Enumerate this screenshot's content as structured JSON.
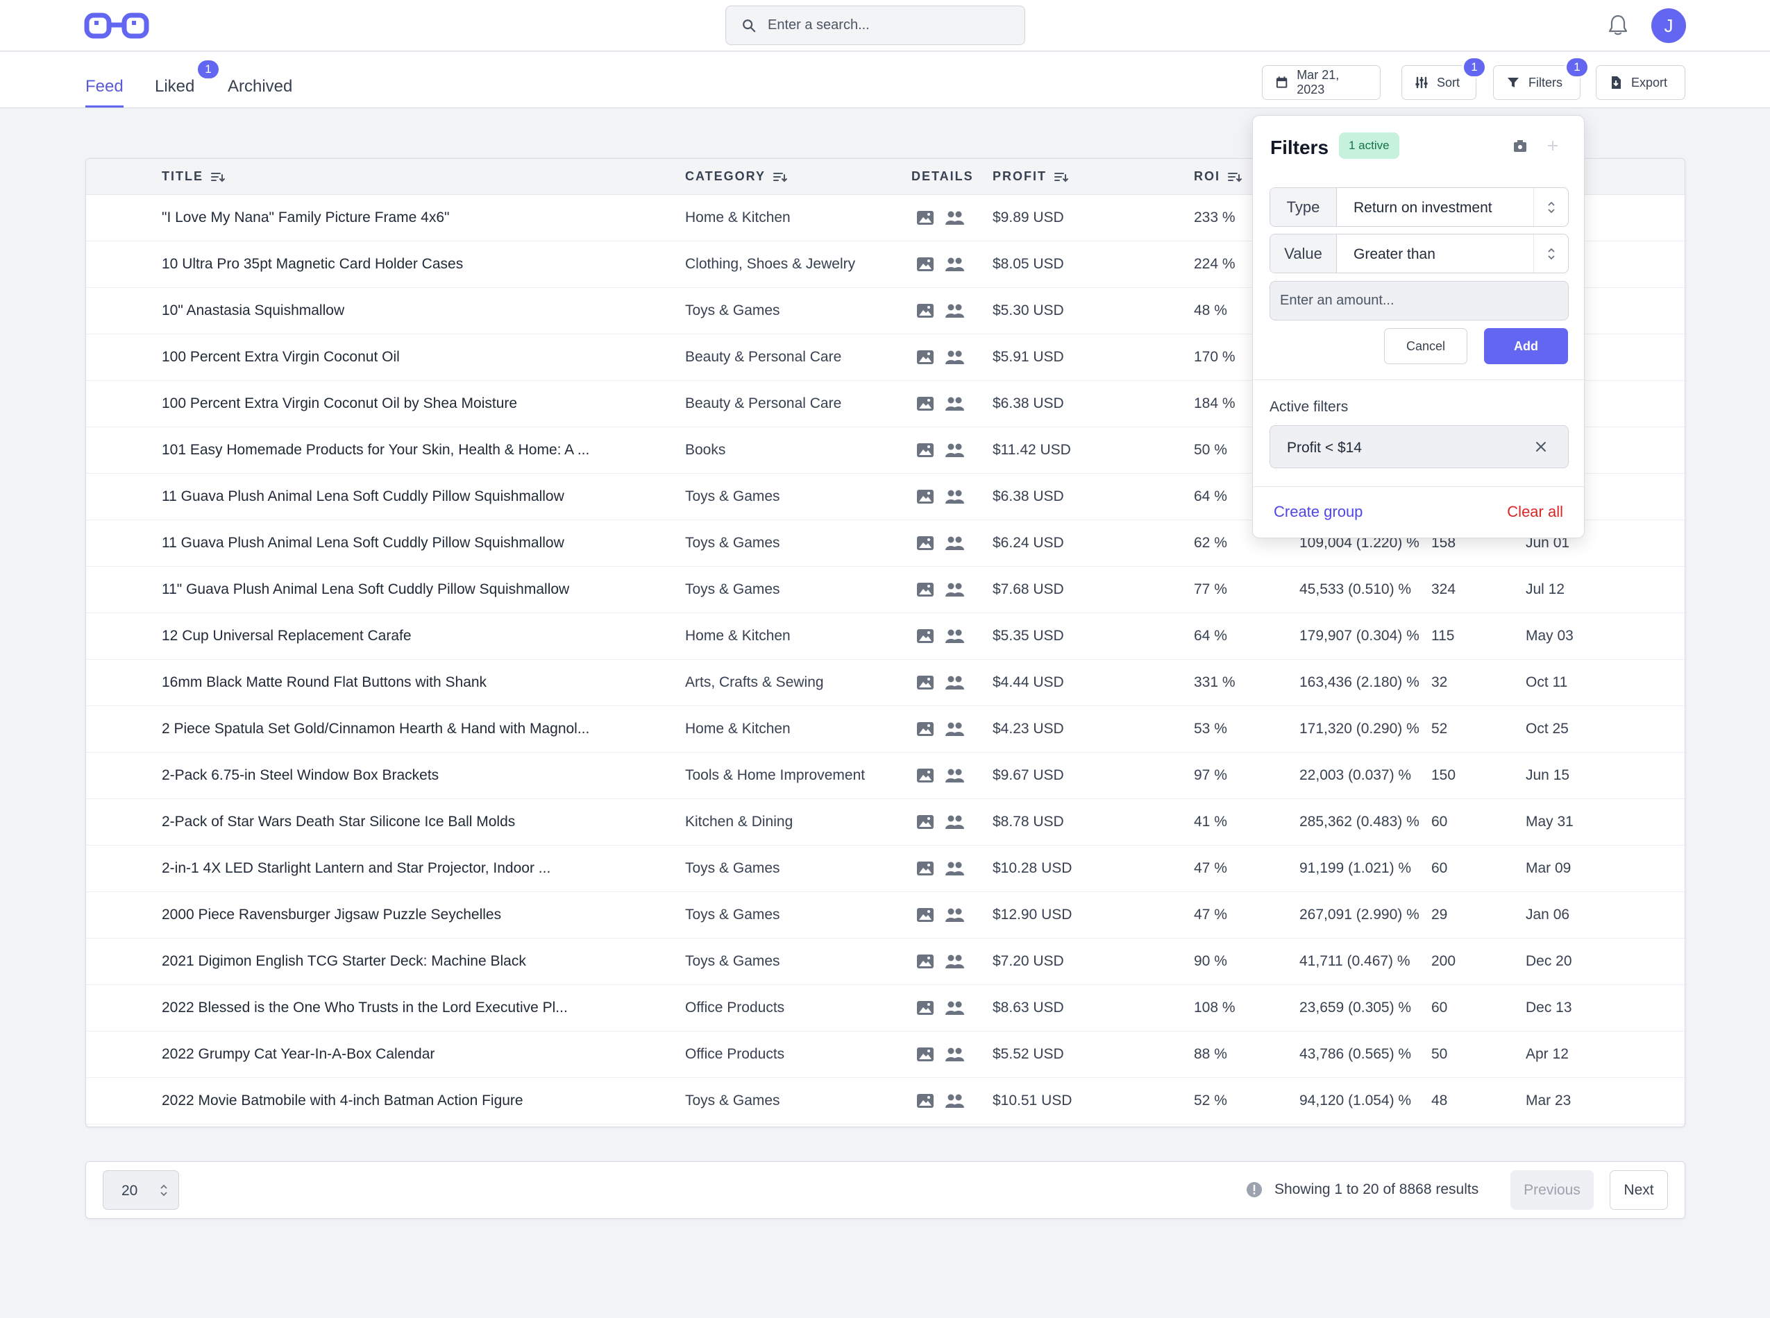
{
  "header": {
    "search_placeholder": "Enter a search...",
    "avatar_initial": "J"
  },
  "tabs": [
    {
      "label": "Feed",
      "active": true
    },
    {
      "label": "Liked",
      "badge": "1"
    },
    {
      "label": "Archived"
    }
  ],
  "toolbar": {
    "date_label": "Mar 21, 2023",
    "sort_label": "Sort",
    "sort_badge": "1",
    "filters_label": "Filters",
    "filters_badge": "1",
    "export_label": "Export"
  },
  "table": {
    "headers": {
      "title": "TITLE",
      "category": "CATEGORY",
      "details": "DETAILS",
      "profit": "PROFIT",
      "roi": "ROI"
    },
    "rows": [
      {
        "title": "\"I Love My Nana\" Family Picture Frame 4x6\"",
        "category": "Home & Kitchen",
        "profit": "$9.89 USD",
        "roi": "233 %",
        "rank": "",
        "count": "",
        "date": ""
      },
      {
        "title": "10 Ultra Pro 35pt Magnetic Card Holder Cases",
        "category": "Clothing, Shoes & Jewelry",
        "profit": "$8.05 USD",
        "roi": "224 %",
        "rank": "",
        "count": "",
        "date": ""
      },
      {
        "title": "10\" Anastasia Squishmallow",
        "category": "Toys & Games",
        "profit": "$5.30 USD",
        "roi": "48 %",
        "rank": "",
        "count": "",
        "date": ""
      },
      {
        "title": "100 Percent Extra Virgin Coconut Oil",
        "category": "Beauty & Personal Care",
        "profit": "$5.91 USD",
        "roi": "170 %",
        "rank": "",
        "count": "",
        "date": ""
      },
      {
        "title": "100 Percent Extra Virgin Coconut Oil by Shea Moisture",
        "category": "Beauty & Personal Care",
        "profit": "$6.38 USD",
        "roi": "184 %",
        "rank": "",
        "count": "",
        "date": ""
      },
      {
        "title": "101 Easy Homemade Products for Your Skin, Health & Home: A ...",
        "category": "Books",
        "profit": "$11.42 USD",
        "roi": "50 %",
        "rank": "",
        "count": "",
        "date": ""
      },
      {
        "title": "11 Guava Plush Animal Lena Soft Cuddly Pillow Squishmallow",
        "category": "Toys & Games",
        "profit": "$6.38 USD",
        "roi": "64 %",
        "rank": "",
        "count": "",
        "date": ""
      },
      {
        "title": "11 Guava Plush Animal Lena Soft Cuddly Pillow Squishmallow",
        "category": "Toys & Games",
        "profit": "$6.24 USD",
        "roi": "62 %",
        "rank": "109,004 (1.220) %",
        "count": "158",
        "date": "Jun 01"
      },
      {
        "title": "11\" Guava Plush Animal Lena Soft Cuddly Pillow Squishmallow",
        "category": "Toys & Games",
        "profit": "$7.68 USD",
        "roi": "77 %",
        "rank": "45,533 (0.510) %",
        "count": "324",
        "date": "Jul 12"
      },
      {
        "title": "12 Cup Universal Replacement Carafe",
        "category": "Home & Kitchen",
        "profit": "$5.35 USD",
        "roi": "64 %",
        "rank": "179,907 (0.304) %",
        "count": "115",
        "date": "May 03"
      },
      {
        "title": "16mm Black Matte Round Flat Buttons with Shank",
        "category": "Arts, Crafts & Sewing",
        "profit": "$4.44 USD",
        "roi": "331 %",
        "rank": "163,436 (2.180) %",
        "count": "32",
        "date": "Oct 11"
      },
      {
        "title": "2 Piece Spatula Set Gold/Cinnamon Hearth & Hand with Magnol...",
        "category": "Home & Kitchen",
        "profit": "$4.23 USD",
        "roi": "53 %",
        "rank": "171,320 (0.290) %",
        "count": "52",
        "date": "Oct 25"
      },
      {
        "title": "2-Pack 6.75-in Steel Window Box Brackets",
        "category": "Tools & Home Improvement",
        "profit": "$9.67 USD",
        "roi": "97 %",
        "rank": "22,003 (0.037) %",
        "count": "150",
        "date": "Jun 15"
      },
      {
        "title": "2-Pack of Star Wars Death Star Silicone Ice Ball Molds",
        "category": "Kitchen & Dining",
        "profit": "$8.78 USD",
        "roi": "41 %",
        "rank": "285,362 (0.483) %",
        "count": "60",
        "date": "May 31"
      },
      {
        "title": "2-in-1 4X LED Starlight Lantern and Star Projector, Indoor ...",
        "category": "Toys & Games",
        "profit": "$10.28 USD",
        "roi": "47 %",
        "rank": "91,199 (1.021) %",
        "count": "60",
        "date": "Mar 09"
      },
      {
        "title": "2000 Piece Ravensburger Jigsaw Puzzle Seychelles",
        "category": "Toys & Games",
        "profit": "$12.90 USD",
        "roi": "47 %",
        "rank": "267,091 (2.990) %",
        "count": "29",
        "date": "Jan 06"
      },
      {
        "title": "2021 Digimon English TCG Starter Deck: Machine Black",
        "category": "Toys & Games",
        "profit": "$7.20 USD",
        "roi": "90 %",
        "rank": "41,711 (0.467) %",
        "count": "200",
        "date": "Dec 20"
      },
      {
        "title": "2022 Blessed is the One Who Trusts in the Lord Executive Pl...",
        "category": "Office Products",
        "profit": "$8.63 USD",
        "roi": "108 %",
        "rank": "23,659 (0.305) %",
        "count": "60",
        "date": "Dec 13"
      },
      {
        "title": "2022 Grumpy Cat Year-In-A-Box Calendar",
        "category": "Office Products",
        "profit": "$5.52 USD",
        "roi": "88 %",
        "rank": "43,786 (0.565) %",
        "count": "50",
        "date": "Apr 12"
      },
      {
        "title": "2022 Movie Batmobile with 4-inch Batman Action Figure",
        "category": "Toys & Games",
        "profit": "$10.51 USD",
        "roi": "52 %",
        "rank": "94,120 (1.054) %",
        "count": "48",
        "date": "Mar 23"
      }
    ]
  },
  "filters_panel": {
    "title": "Filters",
    "active_badge": "1 active",
    "type_label": "Type",
    "type_value": "Return on investment",
    "value_label": "Value",
    "value_value": "Greater than",
    "amount_placeholder": "Enter an amount...",
    "cancel_label": "Cancel",
    "add_label": "Add",
    "active_filters_title": "Active filters",
    "active_filter": "Profit < $14",
    "create_group_label": "Create group",
    "clear_all_label": "Clear all"
  },
  "pagination": {
    "per_page": "20",
    "info": "Showing 1 to 20 of 8868 results",
    "previous_label": "Previous",
    "next_label": "Next"
  },
  "colors": {
    "accent": "#6366f1",
    "danger": "#dc2626",
    "success_bg": "#c6f1dc"
  }
}
